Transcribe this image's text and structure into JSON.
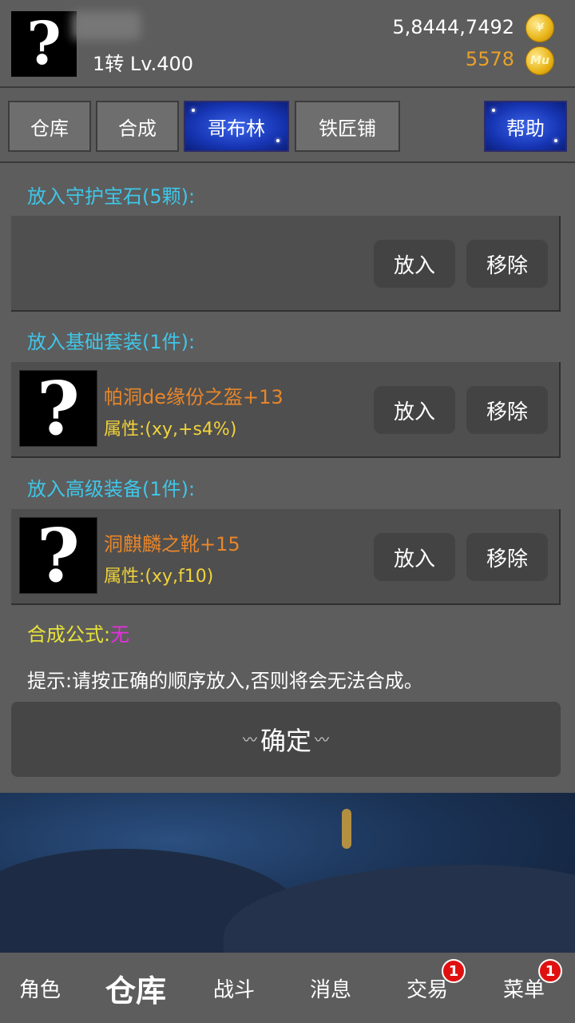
{
  "header": {
    "avatar_glyph": "?",
    "level": "1转 Lv.400",
    "gold": "5,8444,7492",
    "gold_icon": "gold-coin-icon",
    "mu": "5578",
    "mu_icon": "mu-coin-icon",
    "mu_coin_text": "Mu",
    "gold_coin_text": "¥"
  },
  "tabs": [
    {
      "label": "仓库"
    },
    {
      "label": "合成"
    },
    {
      "label": "哥布林"
    },
    {
      "label": "铁匠铺"
    },
    {
      "label": "帮助"
    }
  ],
  "sections": {
    "guard_gem": {
      "label": "放入守护宝石(5颗):"
    },
    "base_set": {
      "label": "放入基础套装(1件):",
      "item_name": "帕洞de缘份之盔+13",
      "item_attr": "属性:(xy,+s4%)"
    },
    "advanced": {
      "label": "放入高级装备(1件):",
      "item_name": "洞麒麟之靴+15",
      "item_attr": "属性:(xy,f10)"
    }
  },
  "buttons": {
    "put": "放入",
    "remove": "移除"
  },
  "formula": {
    "key": "合成公式:",
    "value": "无"
  },
  "tip": "提示:请按正确的顺序放入,否则将会无法合成。",
  "confirm": {
    "label": "确定",
    "orn_left": "〰",
    "orn_right": "〰"
  },
  "nav": [
    {
      "label": "角色"
    },
    {
      "label": "仓库"
    },
    {
      "label": "战斗"
    },
    {
      "label": "消息"
    },
    {
      "label": "交易",
      "badge": "1"
    },
    {
      "label": "菜单",
      "badge": "1"
    }
  ],
  "colors": {
    "accent_blue": "#1736b5",
    "label_cyan": "#3fc6e8",
    "item_orange": "#e8862a",
    "attr_yellow": "#f0d33a",
    "badge_red": "#e01010"
  }
}
